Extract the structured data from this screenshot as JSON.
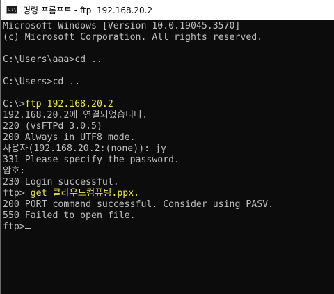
{
  "window": {
    "title": "명령 프롬프트 - ftp  192.168.20.2",
    "icon": "cmd-icon"
  },
  "colors": {
    "background": "#0c0c0c",
    "text": "#c0c0c0",
    "highlight": "#e8e84a"
  },
  "console": {
    "lines": [
      {
        "text": "Microsoft Windows [Version 10.0.19045.3570]"
      },
      {
        "text": "(c) Microsoft Corporation. All rights reserved."
      },
      {
        "text": ""
      },
      {
        "text": "C:\\Users\\aaa>cd .."
      },
      {
        "text": ""
      },
      {
        "text": "C:\\Users>cd .."
      },
      {
        "text": ""
      },
      {
        "text": "C:\\>",
        "highlight": "ftp 192.168.20.2"
      },
      {
        "text": "192.168.20.2에 연결되었습니다."
      },
      {
        "text": "220 (vsFTPd 3.0.5)"
      },
      {
        "text": "200 Always in UTF8 mode."
      },
      {
        "text": "사용자(192.168.20.2:(none)): jy"
      },
      {
        "text": "331 Please specify the password."
      },
      {
        "text": "암호:"
      },
      {
        "text": "230 Login successful."
      },
      {
        "text": "ftp> ",
        "highlight": "get 클라우드컴퓨팅.ppx."
      },
      {
        "text": "200 PORT command successful. Consider using PASV."
      },
      {
        "text": "550 Failed to open file."
      },
      {
        "text": "ftp>",
        "cursor": true
      }
    ]
  }
}
